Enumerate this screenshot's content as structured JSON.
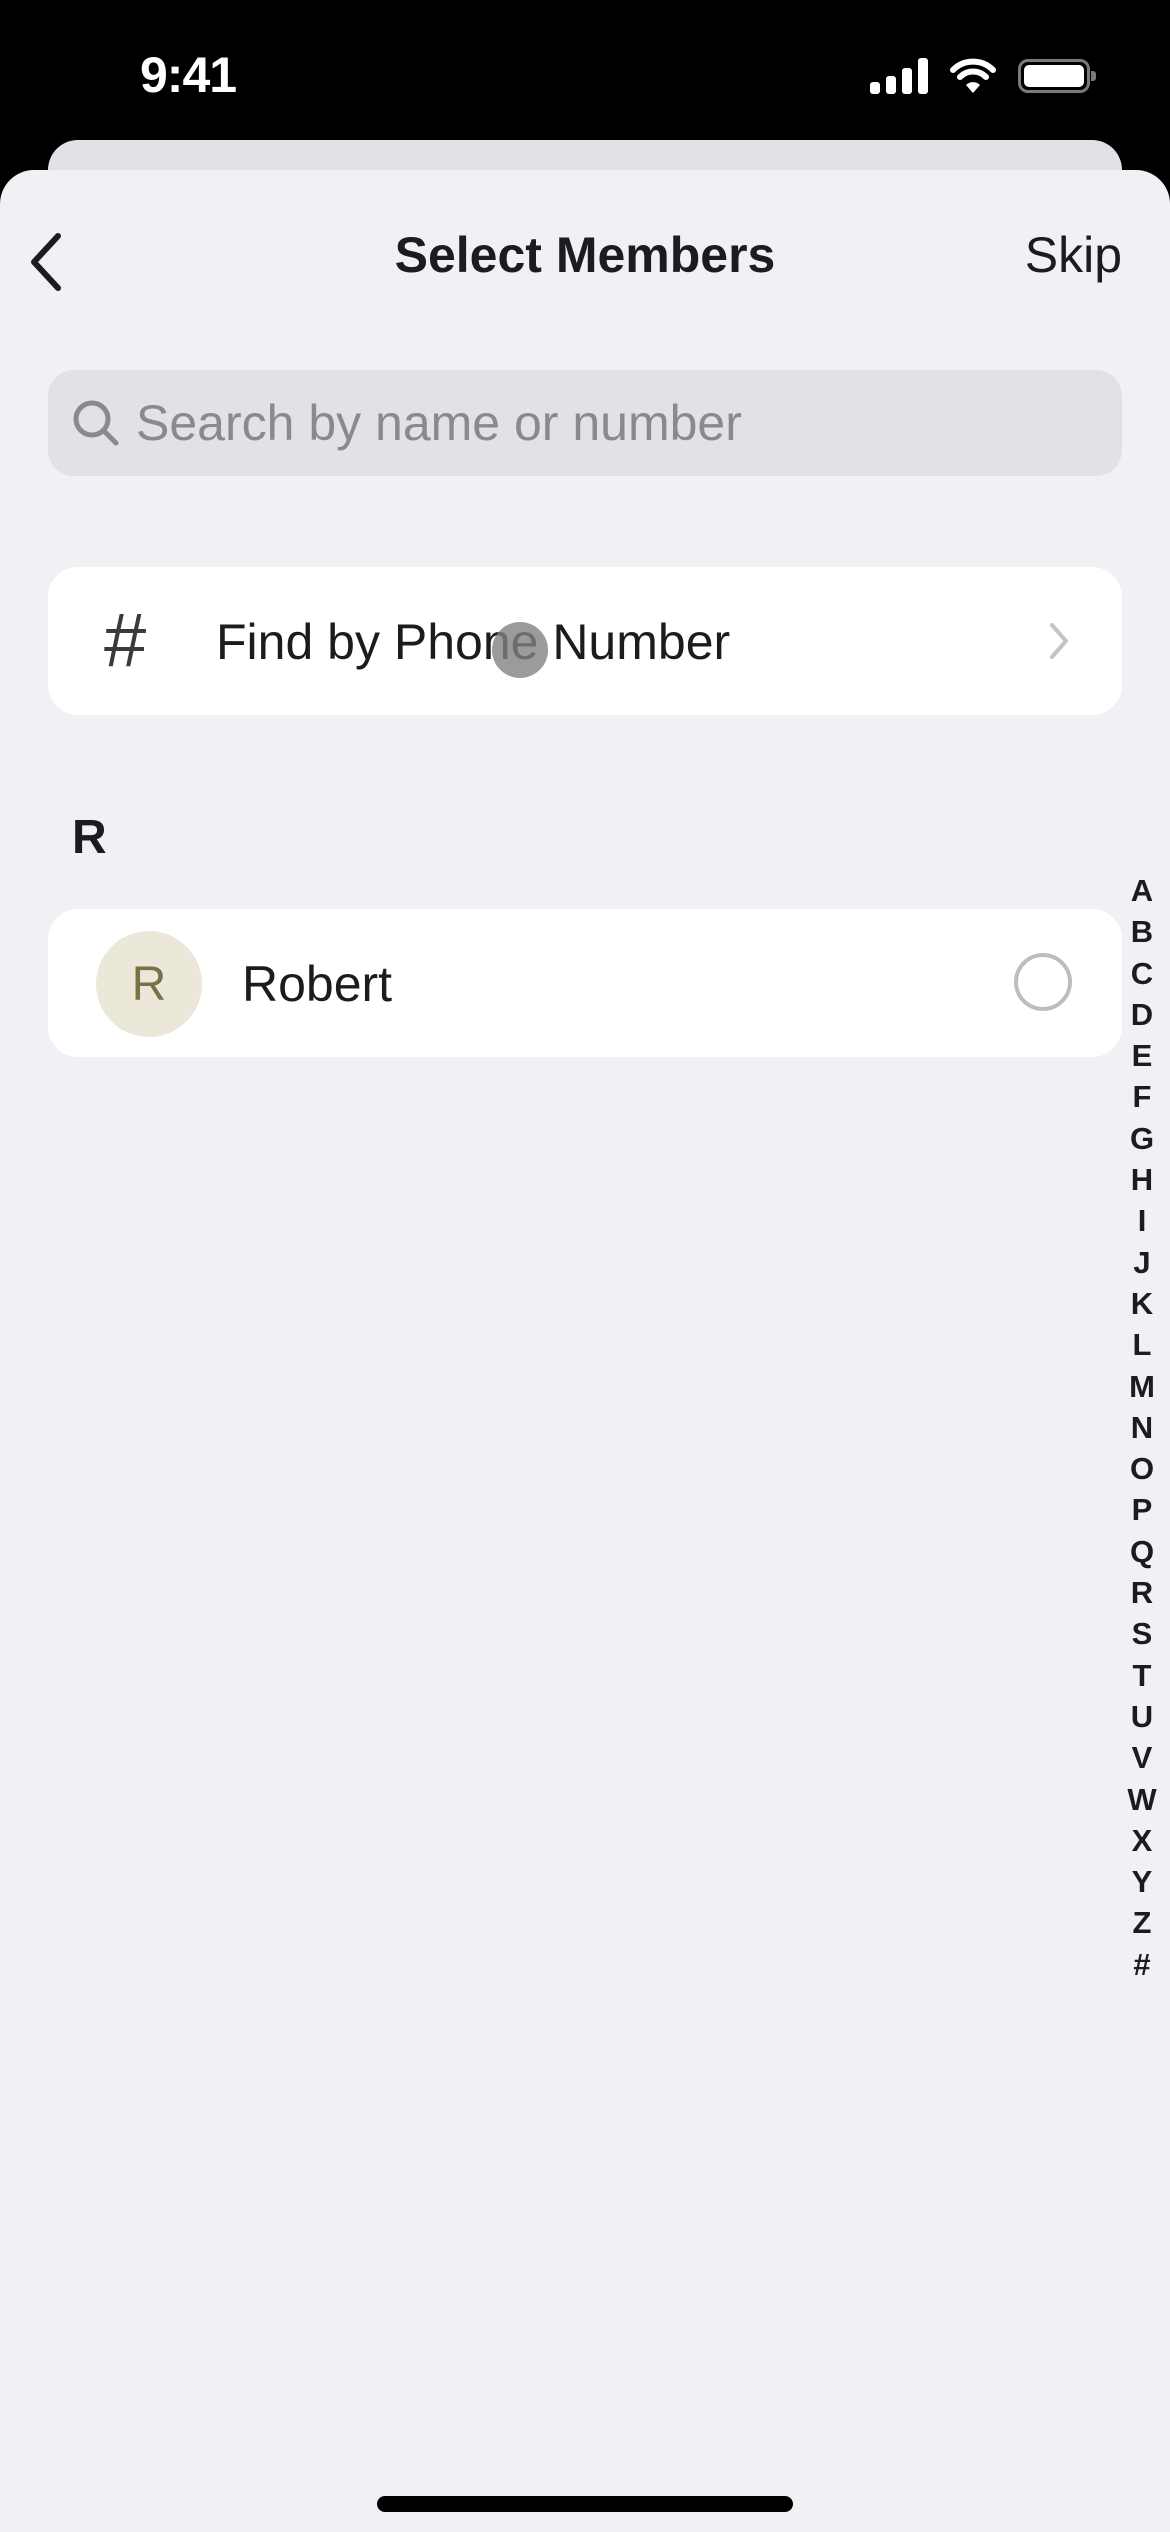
{
  "status_bar": {
    "time": "9:41",
    "icons": [
      "cellular-signal-icon",
      "wifi-icon",
      "battery-icon"
    ]
  },
  "nav": {
    "back_icon": "chevron-left-icon",
    "title": "Select Members",
    "skip_label": "Skip"
  },
  "search": {
    "placeholder": "Search by name or number",
    "value": "",
    "icon": "search-icon"
  },
  "find_by_phone": {
    "icon": "hash-icon",
    "icon_glyph": "#",
    "label": "Find by Phone Number",
    "chevron": "chevron-right-icon"
  },
  "sections": [
    {
      "header": "R",
      "contacts": [
        {
          "initial": "R",
          "name": "Robert",
          "selected": false,
          "avatar_bg": "#ebe8da",
          "avatar_fg": "#7a7245"
        }
      ]
    }
  ],
  "index_bar": [
    "A",
    "B",
    "C",
    "D",
    "E",
    "F",
    "G",
    "H",
    "I",
    "J",
    "K",
    "L",
    "M",
    "N",
    "O",
    "P",
    "Q",
    "R",
    "S",
    "T",
    "U",
    "V",
    "W",
    "X",
    "Y",
    "Z",
    "#"
  ]
}
